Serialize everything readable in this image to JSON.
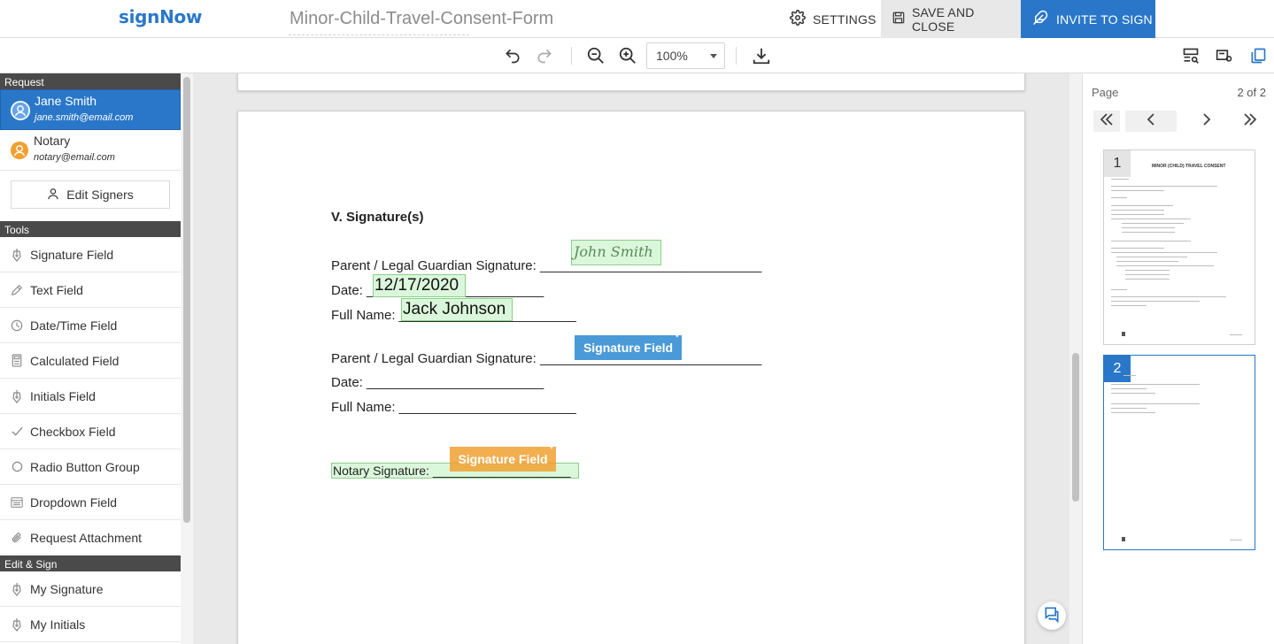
{
  "app": {
    "logo": "signNow",
    "document_title": "Minor-Child-Travel-Consent-Form",
    "settings_label": "SETTINGS",
    "save_label": "SAVE AND CLOSE",
    "invite_label": "INVITE TO SIGN"
  },
  "toolbar": {
    "zoom_value": "100%"
  },
  "sidebar": {
    "request_header": "Request",
    "signers": [
      {
        "name": "Jane Smith",
        "email": "jane.smith@email.com",
        "color": "#2a77c9"
      },
      {
        "name": "Notary",
        "email": "notary@email.com",
        "color": "#f0a030"
      }
    ],
    "edit_signers_label": "Edit Signers",
    "tools_header": "Tools",
    "tools": [
      {
        "label": "Signature Field",
        "icon": "pen-nib-icon"
      },
      {
        "label": "Text Field",
        "icon": "pencil-icon"
      },
      {
        "label": "Date/Time Field",
        "icon": "clock-icon"
      },
      {
        "label": "Calculated Field",
        "icon": "calculator-icon"
      },
      {
        "label": "Initials Field",
        "icon": "pen-nib-icon"
      },
      {
        "label": "Checkbox Field",
        "icon": "checkmark-icon"
      },
      {
        "label": "Radio Button Group",
        "icon": "radio-circle-icon"
      },
      {
        "label": "Dropdown Field",
        "icon": "dropdown-list-icon"
      },
      {
        "label": "Request Attachment",
        "icon": "paperclip-icon"
      }
    ],
    "edit_sign_header": "Edit & Sign",
    "edit_sign_items": [
      {
        "label": "My Signature",
        "icon": "pen-nib-icon"
      },
      {
        "label": "My Initials",
        "icon": "pen-nib-icon"
      }
    ]
  },
  "document": {
    "heading": "V. Signature(s)",
    "guardian1_sig_label": "Parent / Legal Guardian Signature: ______________________________",
    "guardian1_signature": "John Smith",
    "date1_label": "Date: ________________________",
    "date1_value": "12/17/2020",
    "name1_label": "Full Name: ________________________",
    "name1_value": "Jack Johnson",
    "guardian2_sig_label": "Parent / Legal Guardian Signature: ______________________________",
    "guardian2_field": "Signature Field",
    "date2_label": "Date: ________________________",
    "name2_label": "Full Name: ________________________",
    "notary_label": "Notary Signature: ____________________",
    "notary_field": "Signature Field",
    "required_mark": "*"
  },
  "pages_panel": {
    "label": "Page",
    "count": "2 of 2",
    "thumbnails": [
      {
        "number": "1",
        "title": "MINOR (CHILD) TRAVEL CONSENT"
      },
      {
        "number": "2"
      }
    ]
  },
  "colors": {
    "brand": "#2a77c9",
    "notary": "#f0a030",
    "signer1_field": "#4a9ad8"
  }
}
